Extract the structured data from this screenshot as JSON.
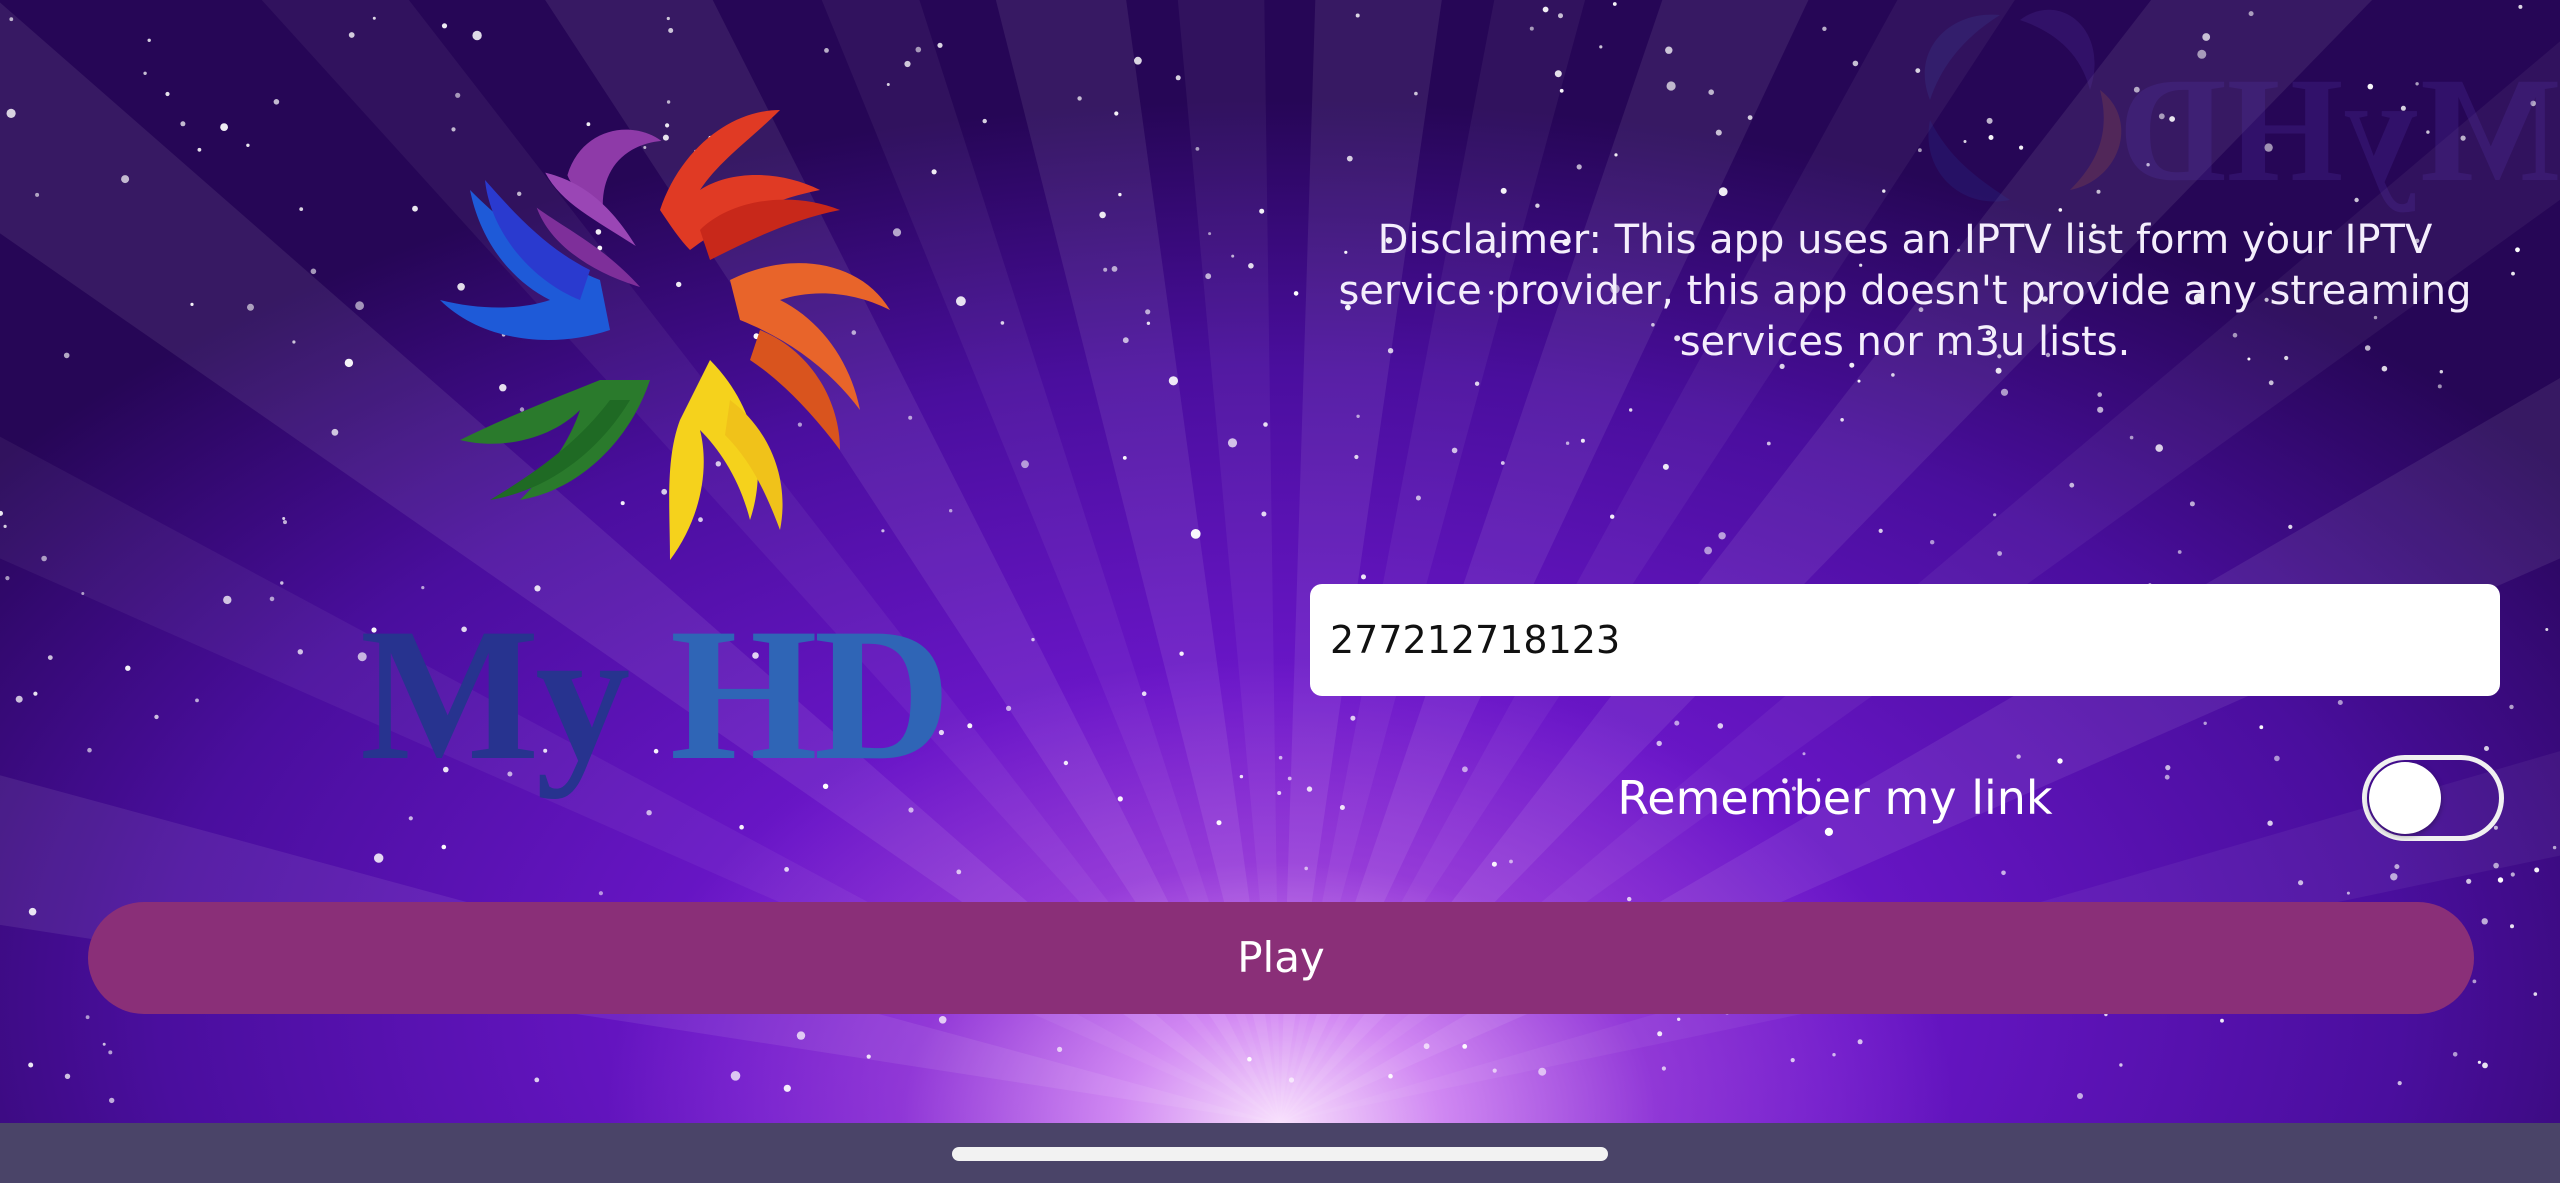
{
  "app": {
    "logo_text_my": "My",
    "logo_text_hd": "HD",
    "logo_icon": "myhd-swirl-logo"
  },
  "disclaimer": {
    "text": "Disclaimer: This app uses an IPTV list form your IPTV service provider, this app doesn't provide any streaming services nor m3u lists."
  },
  "link_input": {
    "value": "277212718123",
    "placeholder": ""
  },
  "remember": {
    "label": "Remember my link",
    "enabled": false
  },
  "play_button": {
    "label": "Play"
  },
  "colors": {
    "play_button": "#8a2f78",
    "background_top": "#260656",
    "background_center": "#6a16c8",
    "logo_my": "#27338f",
    "logo_hd": "#2f65b6",
    "home_bar": "#4a4468"
  }
}
